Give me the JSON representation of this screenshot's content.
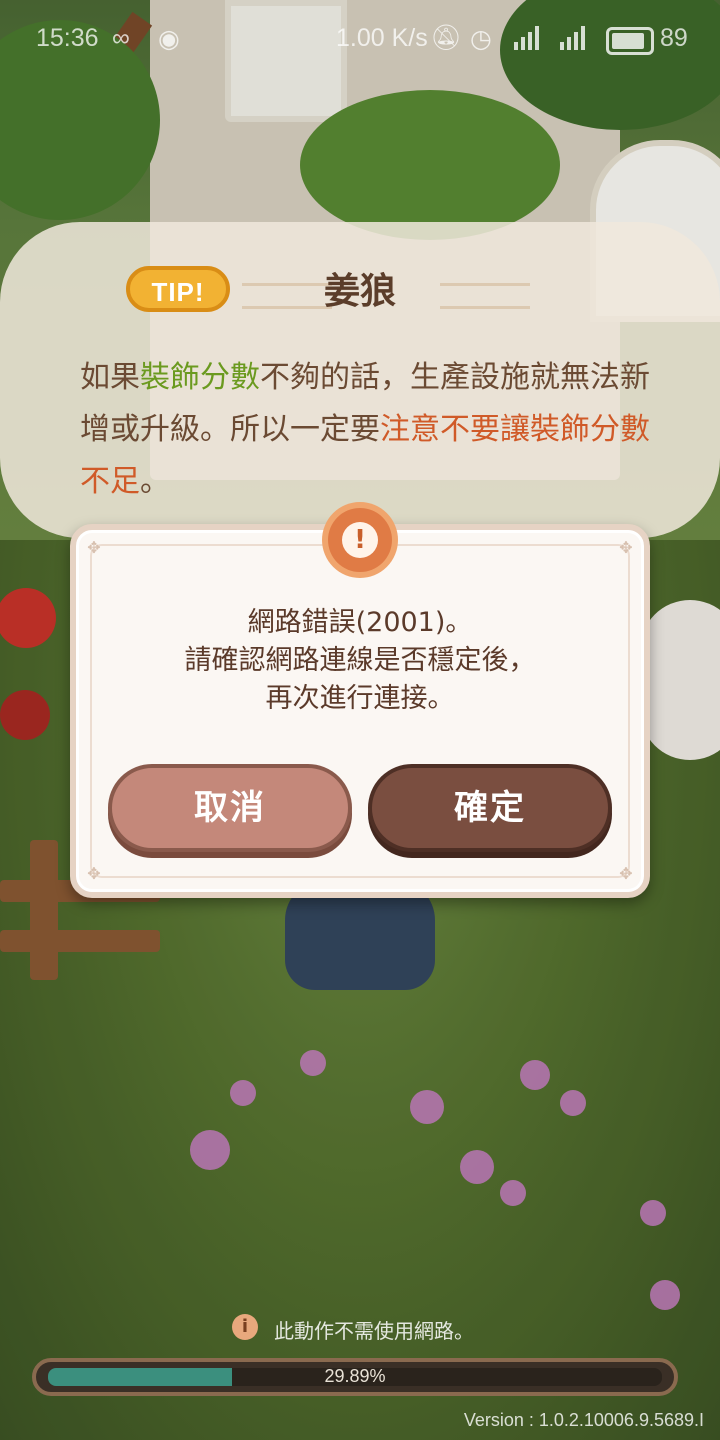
{
  "status_bar": {
    "time": "15:36",
    "net_speed": "1.00 K/s",
    "battery_percent": "89",
    "icons": [
      "infinity-icon",
      "sync-icon",
      "mute-icon",
      "alarm-icon",
      "signal-4g-icon",
      "signal-4g-plus-icon",
      "battery-icon"
    ]
  },
  "tip": {
    "badge": "TIP!",
    "speaker": "姜狼",
    "text_parts": [
      {
        "text": "如果",
        "style": "normal"
      },
      {
        "text": "裝飾分數",
        "style": "green"
      },
      {
        "text": "不夠的話，生產設施就無法新增或升級。所以一定要",
        "style": "normal"
      },
      {
        "text": "注意不要讓裝飾分數不足",
        "style": "red"
      },
      {
        "text": "。",
        "style": "normal"
      }
    ]
  },
  "dialog": {
    "icon": "warning-icon",
    "message_lines": [
      "網路錯誤(2001)。",
      "請確認網路連線是否穩定後，",
      "再次進行連接。"
    ],
    "cancel_label": "取消",
    "confirm_label": "確定"
  },
  "loading": {
    "info_text": "此動作不需使用網路。",
    "progress_text": "29.89%",
    "progress_value": 0.2989,
    "version": "Version : 1.0.2.10006.9.5689.I"
  },
  "colors": {
    "accent_green": "#6b9a1f",
    "accent_red": "#d05a28",
    "button_cancel": "#c4887a",
    "button_confirm": "#7a4e40"
  }
}
